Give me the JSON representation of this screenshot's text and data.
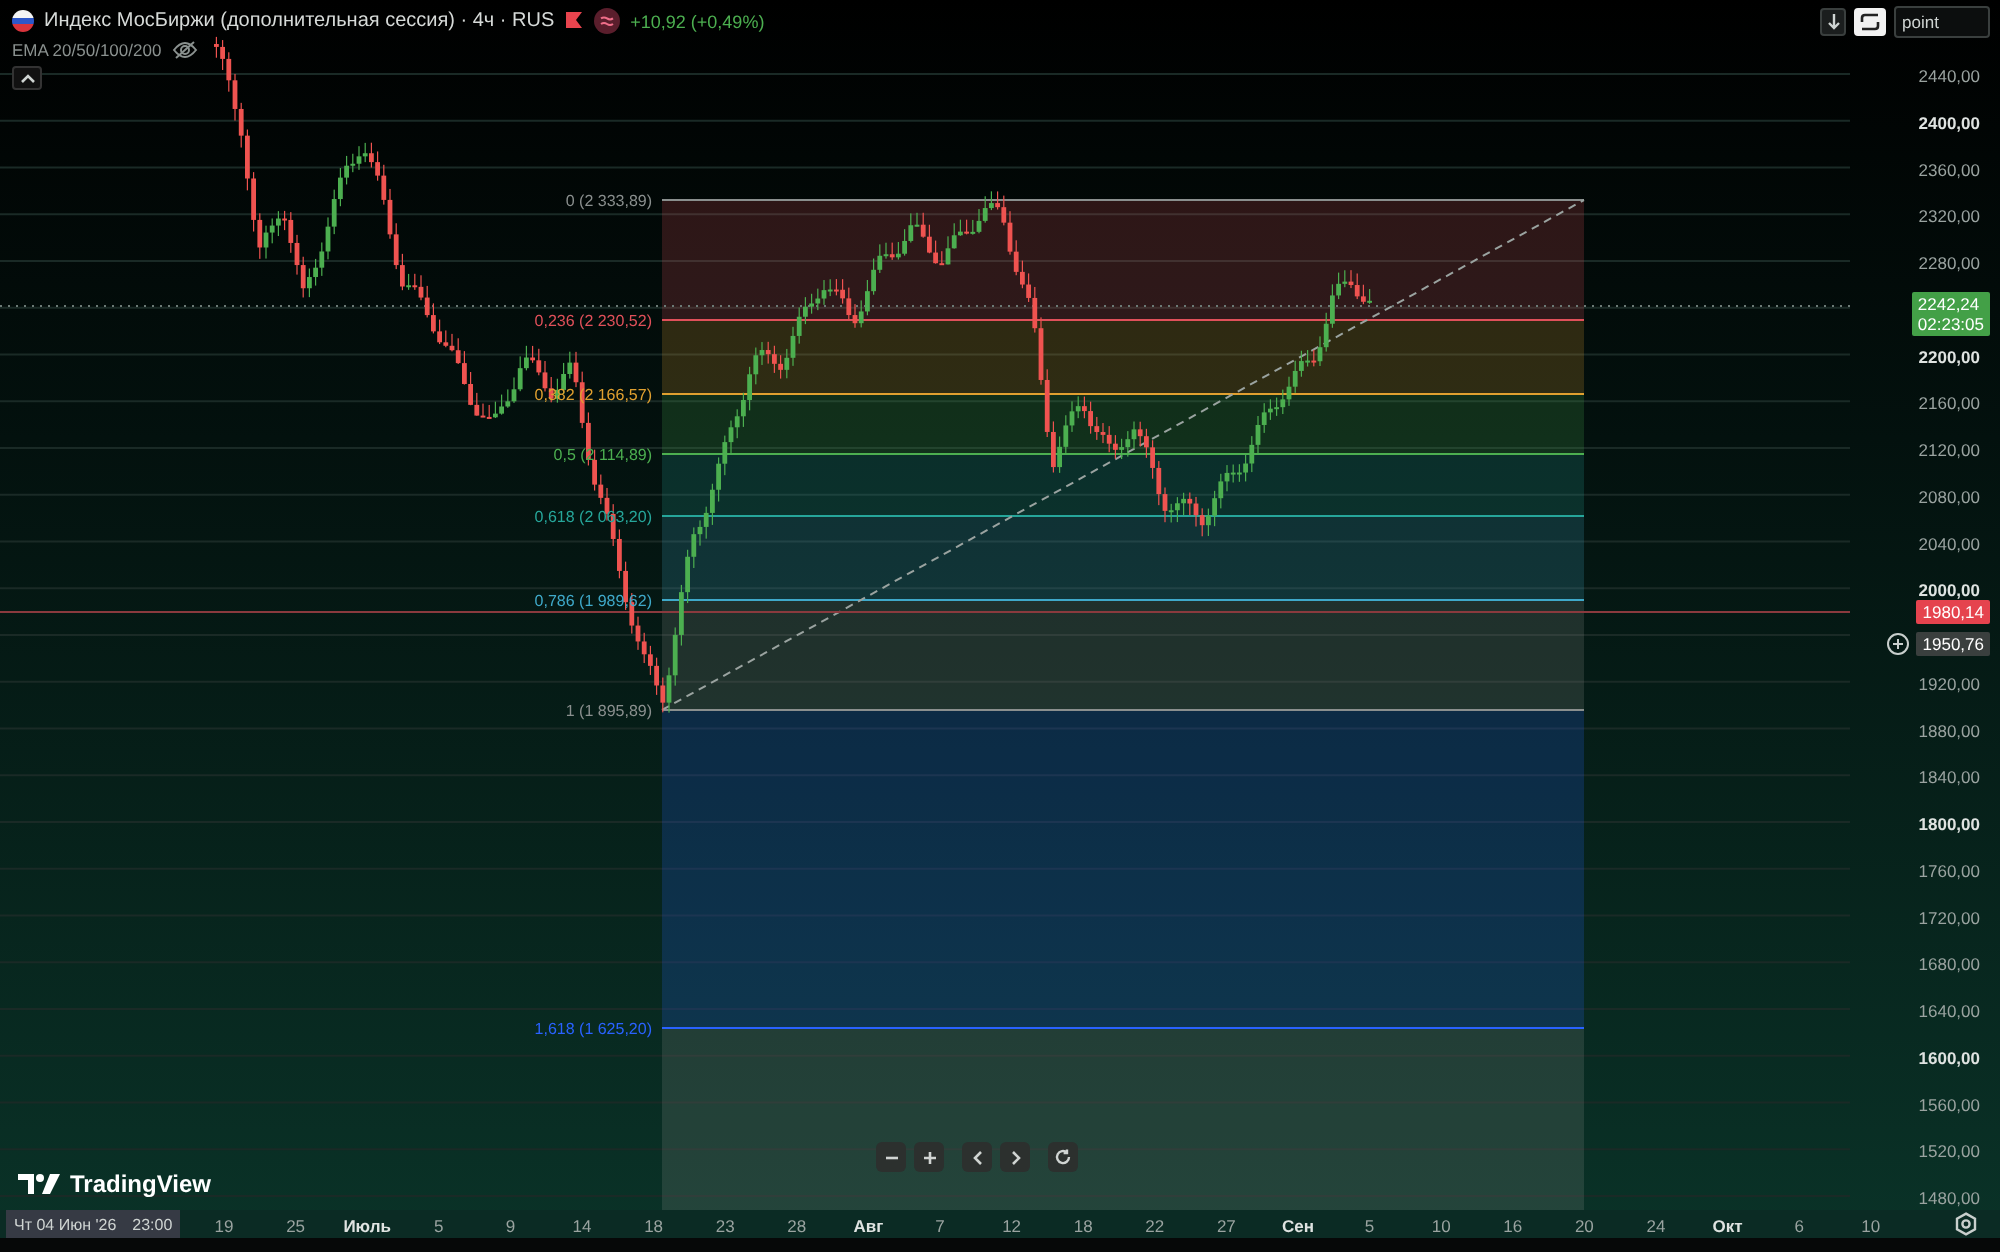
{
  "legend": {
    "title": "Индекс МосБиржи (дополнительная сессия) · 4ч · RUS",
    "change": "+10,92 (+0,49%)",
    "indicator": "EMA 20/50/100/200"
  },
  "toolbar": {
    "input_value": "point"
  },
  "fibonacci": [
    {
      "label": "0 (2 333,89)",
      "color": "#8a8f8e"
    },
    {
      "label": "0,236 (2 230,52)",
      "color": "#e0505a"
    },
    {
      "label": "0,382 (2 166,57)",
      "color": "#e0a030"
    },
    {
      "label": "0,5 (2 114,89)",
      "color": "#4caf50"
    },
    {
      "label": "0,618 (2 063,20)",
      "color": "#26a69a"
    },
    {
      "label": "0,786 (1 989,62)",
      "color": "#3fa9c9"
    },
    {
      "label": "1 (1 895,89)",
      "color": "#8a8f8e"
    },
    {
      "label": "1,618 (1 625,20)",
      "color": "#2962ff"
    }
  ],
  "price_axis": [
    {
      "label": "2440,00",
      "emphasized": false
    },
    {
      "label": "2400,00",
      "emphasized": true
    },
    {
      "label": "2360,00",
      "emphasized": false
    },
    {
      "label": "2320,00",
      "emphasized": false
    },
    {
      "label": "2280,00",
      "emphasized": false
    },
    {
      "label": "2200,00",
      "emphasized": true
    },
    {
      "label": "2160,00",
      "emphasized": false
    },
    {
      "label": "2120,00",
      "emphasized": false
    },
    {
      "label": "2080,00",
      "emphasized": false
    },
    {
      "label": "2040,00",
      "emphasized": false
    },
    {
      "label": "2000,00",
      "emphasized": true
    },
    {
      "label": "1920,00",
      "emphasized": false
    },
    {
      "label": "1880,00",
      "emphasized": false
    },
    {
      "label": "1840,00",
      "emphasized": false
    },
    {
      "label": "1800,00",
      "emphasized": true
    },
    {
      "label": "1760,00",
      "emphasized": false
    },
    {
      "label": "1720,00",
      "emphasized": false
    },
    {
      "label": "1680,00",
      "emphasized": false
    },
    {
      "label": "1640,00",
      "emphasized": false
    },
    {
      "label": "1600,00",
      "emphasized": true
    },
    {
      "label": "1560,00",
      "emphasized": false
    },
    {
      "label": "1520,00",
      "emphasized": false
    },
    {
      "label": "1480,00",
      "emphasized": false
    }
  ],
  "price_tags": [
    {
      "kind": "last",
      "price": "2242,24",
      "countdown": "02:23:05"
    },
    {
      "kind": "alert",
      "price": "1980,14"
    },
    {
      "kind": "cursor",
      "price": "1950,76"
    }
  ],
  "time_axis": [
    {
      "label": "19",
      "emphasized": false
    },
    {
      "label": "25",
      "emphasized": false
    },
    {
      "label": "Июль",
      "emphasized": true
    },
    {
      "label": "5",
      "emphasized": false
    },
    {
      "label": "9",
      "emphasized": false
    },
    {
      "label": "14",
      "emphasized": false
    },
    {
      "label": "18",
      "emphasized": false
    },
    {
      "label": "23",
      "emphasized": false
    },
    {
      "label": "28",
      "emphasized": false
    },
    {
      "label": "Авг",
      "emphasized": true
    },
    {
      "label": "7",
      "emphasized": false
    },
    {
      "label": "12",
      "emphasized": false
    },
    {
      "label": "18",
      "emphasized": false
    },
    {
      "label": "22",
      "emphasized": false
    },
    {
      "label": "27",
      "emphasized": false
    },
    {
      "label": "Сен",
      "emphasized": true
    },
    {
      "label": "5",
      "emphasized": false
    },
    {
      "label": "10",
      "emphasized": false
    },
    {
      "label": "16",
      "emphasized": false
    },
    {
      "label": "20",
      "emphasized": false
    },
    {
      "label": "24",
      "emphasized": false
    },
    {
      "label": "Окт",
      "emphasized": true
    },
    {
      "label": "6",
      "emphasized": false
    },
    {
      "label": "10",
      "emphasized": false
    }
  ],
  "crosshair": {
    "date": "Чт 04 Июн '26",
    "time": "23:00"
  },
  "logo": "TradingView"
}
